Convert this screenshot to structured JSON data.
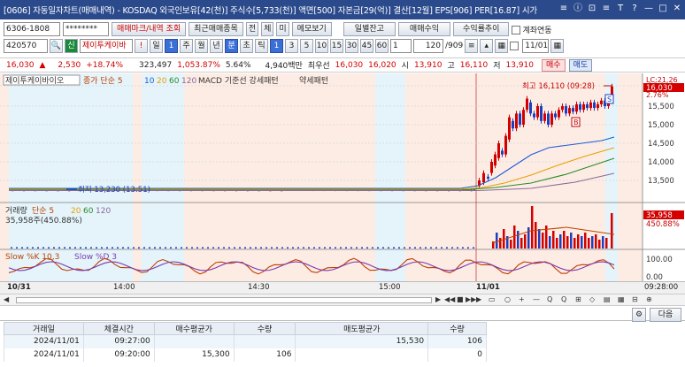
{
  "window": {
    "title": "[0606] 자동일자차트(매매내역) - KOSDAQ 외국인보유[42(천)] 주식수[5,733(천)] 액면[500] 자본금[29(억)] 결산[12월] EPS[906] PER[16.87] 시가",
    "buttons": [
      "≡",
      "ⓘ",
      "⊡",
      "≡",
      "T",
      "?",
      "—",
      "□",
      "✕"
    ]
  },
  "toolbar1": {
    "account": "6306-1808",
    "password": "********",
    "btn_trades": "매매마크/내역 조회",
    "btn_recent": "최근매매종목",
    "btn_jeon": "전",
    "btn_che": "체",
    "btn_mi": "미",
    "btn_memo": "메모보기",
    "btn_daily_balance": "일별잔고",
    "btn_trade_profit": "매매수익",
    "btn_yield": "수익률추이",
    "check_account_link": "계좌연동"
  },
  "toolbar2": {
    "code": "420570",
    "credit_badge": "신",
    "stock_name": "제이투케이바",
    "excl": "!",
    "period_il": "일",
    "period_num": "1",
    "periods": [
      "주",
      "월",
      "년",
      "분",
      "초",
      "틱"
    ],
    "minutes": [
      "1",
      "3",
      "5",
      "10",
      "15",
      "30",
      "45",
      "60"
    ],
    "num_value": "1",
    "page": "120",
    "page_total": "/909",
    "date": "11/01"
  },
  "quote": {
    "price": "16,030",
    "change": "2,530",
    "change_pct": "+18.74%",
    "volume": "323,497",
    "vol_pct": "1,053.87%",
    "turnover": "5.64%",
    "amount": "4,940백만",
    "priority_label": "최우선",
    "ask": "16,030",
    "bid": "16,020",
    "open_label": "시",
    "open": "13,910",
    "high_label": "고",
    "high": "16,110",
    "low_label": "저",
    "low": "13,910",
    "buy_btn": "매수",
    "sell_btn": "매도"
  },
  "chart_data": {
    "type": "candlestick",
    "legend": [
      "제이투케이바이오",
      "종가 단순 5",
      "10",
      "20",
      "60",
      "120",
      "MACD 기준선 강세패턴",
      "약세패턴"
    ],
    "y_ticks": [
      "16,000",
      "15,500",
      "15,000",
      "14,500",
      "14,000",
      "13,500"
    ],
    "current_price_label": "16,030",
    "lc_label": "LC:21.26",
    "pct_label": "2.76%",
    "high_marker": "최고 16,110 (09:28)",
    "low_marker": "최저 13,230 (13:51)",
    "s_marker": "S",
    "b_marker": "B",
    "volume_legend": [
      "거래량",
      "단순 5",
      "20",
      "60",
      "120"
    ],
    "volume_value": "35,958주(450.88%)",
    "volume_last_label": "35,958",
    "volume_pct_label": "450.88%",
    "stoch_legend": [
      "Slow %K 10,3",
      "Slow %D 3"
    ],
    "stoch_ticks": [
      "100.00",
      "0.00"
    ],
    "x_ticks": [
      "10/31",
      "14:00",
      "14:30",
      "15:00",
      "11/01",
      "09:28:00"
    ]
  },
  "navbar": {
    "buttons": [
      "◀",
      "▶",
      "◀◀",
      "■",
      "▶▶",
      "▶"
    ],
    "tools": [
      "▭",
      "○",
      "+",
      "—",
      "Q",
      "Q",
      "⊞",
      "◇",
      "▤",
      "▦",
      "⊟",
      "⊕"
    ]
  },
  "bottom": {
    "next_btn": "다음",
    "gear": "⚙"
  },
  "table": {
    "headers": [
      "거래일",
      "체결시간",
      "매수평균가",
      "수량",
      "매도평균가",
      "수량"
    ],
    "rows": [
      [
        "2024/11/01",
        "09:27:00",
        "",
        "",
        "15,530",
        "106"
      ],
      [
        "2024/11/01",
        "09:20:00",
        "15,300",
        "106",
        "",
        "0"
      ]
    ]
  }
}
